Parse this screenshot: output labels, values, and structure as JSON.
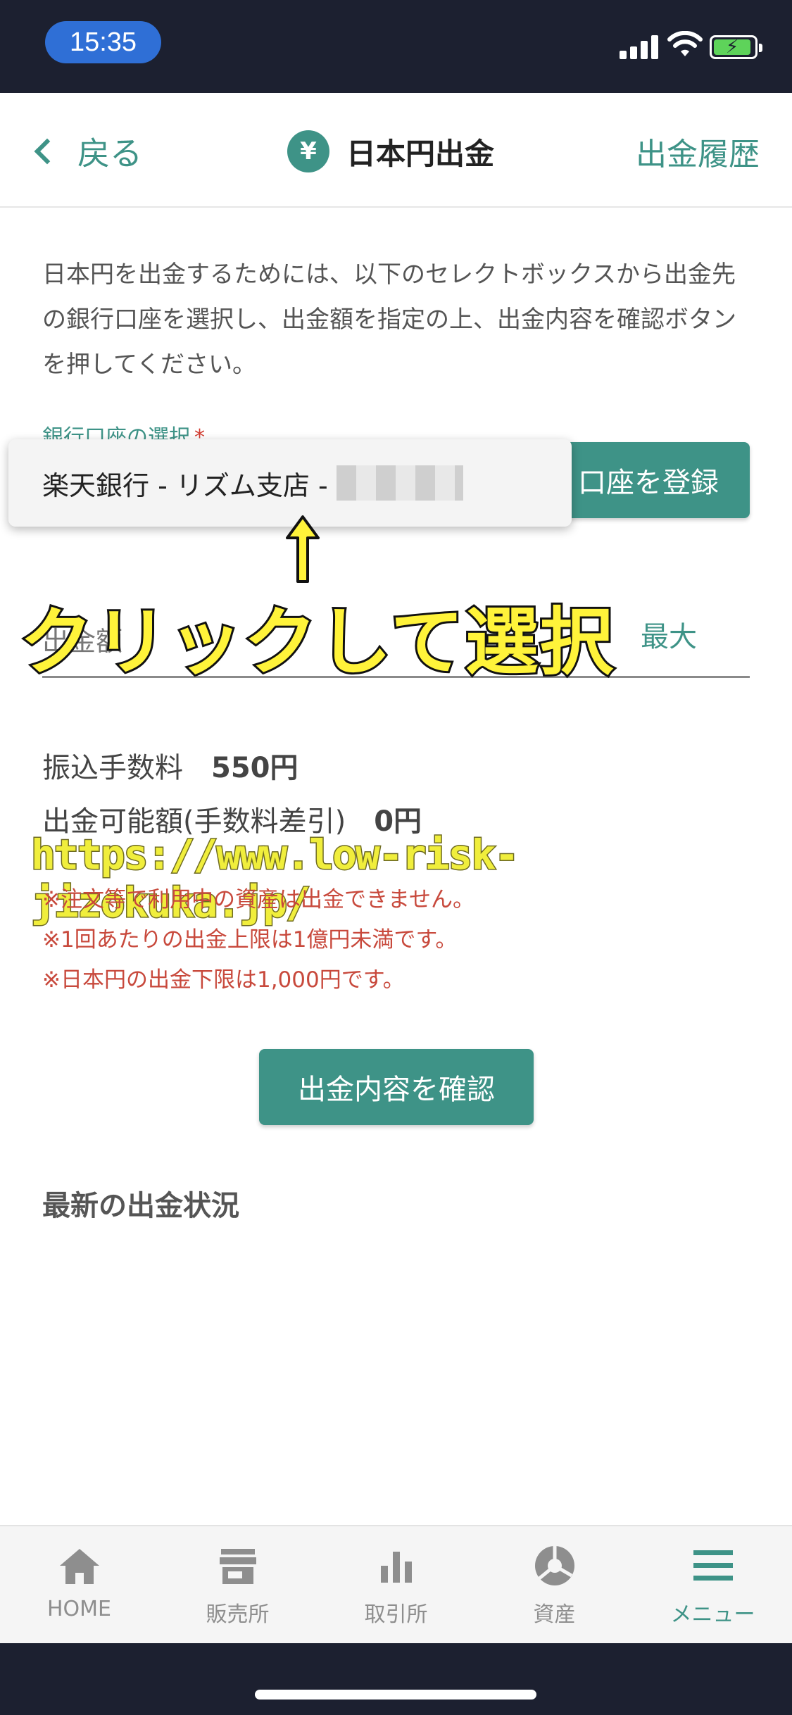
{
  "status_bar": {
    "time": "15:35"
  },
  "header": {
    "back_label": "戻る",
    "yen_symbol": "¥",
    "title": "日本円出金",
    "history_label": "出金履歴"
  },
  "description": "日本円を出金するためには、以下のセレクトボックスから出金先の銀行口座を選択し、出金額を指定の上、出金内容を確認ボタンを押してください。",
  "account": {
    "label": "銀行口座の選択",
    "required_mark": "*",
    "selected_value": "楽天銀行 - リズム支店 -",
    "register_label": "口座を登録"
  },
  "amount": {
    "label": "出金額",
    "max_label": "最大"
  },
  "annotation": {
    "caption": "クリックして選択",
    "arrow": "↑",
    "watermark": "https://www.low-risk-jizokuka.jp/"
  },
  "fees": {
    "fee_label": "振込手数料",
    "fee_value": "550円",
    "available_label": "出金可能額(手数料差引)",
    "available_value": "0円"
  },
  "notes": [
    "※注文等で利用中の資産は出金できません。",
    "※1回あたりの出金上限は1億円未満です。",
    "※日本円の出金下限は1,000円です。"
  ],
  "confirm_label": "出金内容を確認",
  "latest_label": "最新の出金状況",
  "tabs": [
    {
      "label": "HOME",
      "icon": "home-icon",
      "active": false
    },
    {
      "label": "販売所",
      "icon": "store-icon",
      "active": false
    },
    {
      "label": "取引所",
      "icon": "bar-chart-icon",
      "active": false
    },
    {
      "label": "資産",
      "icon": "pie-chart-icon",
      "active": false
    },
    {
      "label": "メニュー",
      "icon": "menu-icon",
      "active": true
    }
  ],
  "colors": {
    "accent": "#3e9387",
    "warning": "#c8493c",
    "caption_yellow": "#fff33a"
  }
}
